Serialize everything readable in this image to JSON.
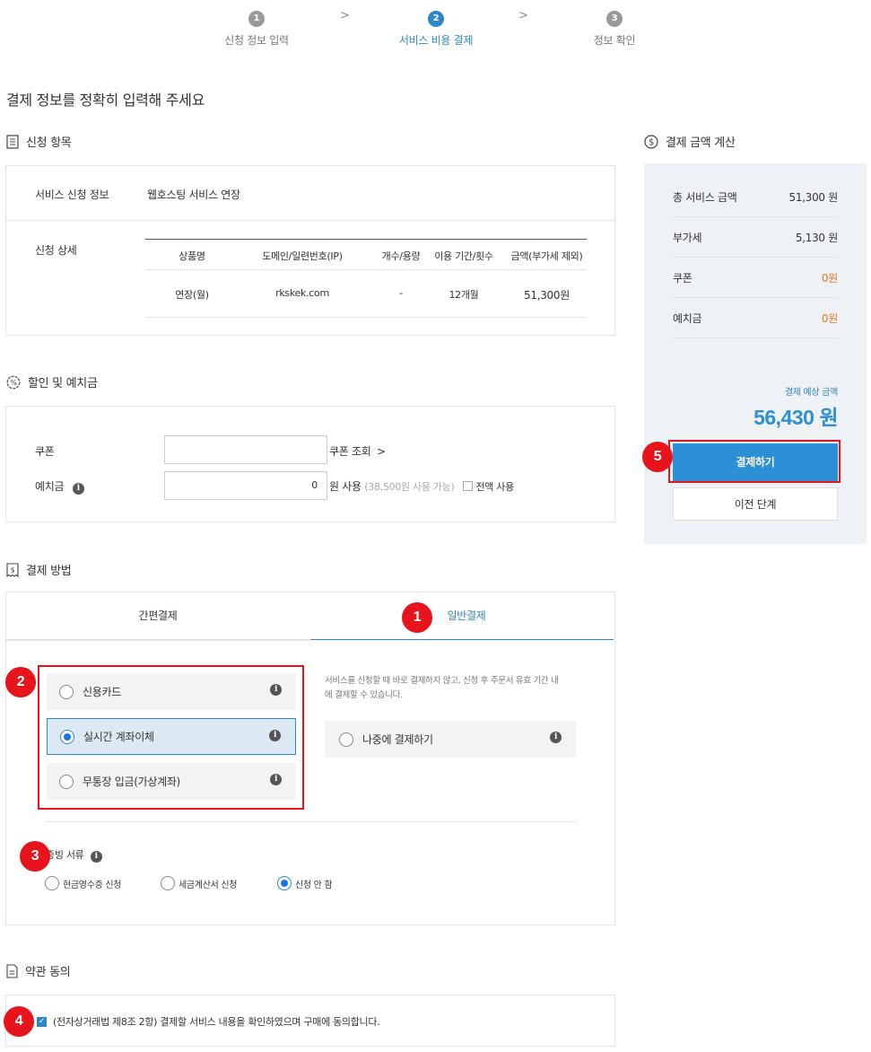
{
  "steps": [
    {
      "num": "1",
      "label": "신청 정보 입력"
    },
    {
      "num": "2",
      "label": "서비스 비용 결제"
    },
    {
      "num": "3",
      "label": "정보 확인"
    }
  ],
  "page_title": "결제 정보를 정확히 입력해 주세요",
  "application": {
    "heading": "신청 항목",
    "service_info_label": "서비스 신청 정보",
    "service_info_value": "웹호스팅 서비스 연장",
    "detail_label": "신청 상세",
    "table_headers": [
      "상품명",
      "도메인/일련번호(IP)",
      "개수/용량",
      "이용 기간/횟수",
      "금액(부가세 제외)"
    ],
    "table_row": [
      "연장(월)",
      "rkskek.com",
      "-",
      "12개월",
      "51,300원"
    ]
  },
  "discount": {
    "heading": "할인 및 예치금",
    "coupon_label": "쿠폰",
    "coupon_value": "",
    "coupon_lookup": "쿠폰 조회",
    "deposit_label": "예치금",
    "deposit_value": "0",
    "deposit_use": "원 사용",
    "deposit_available": "(38,500원 사용 가능)",
    "use_all": "전액 사용"
  },
  "payment": {
    "heading": "결제 방법",
    "tabs": [
      "간편결제",
      "일반결제"
    ],
    "options": [
      "신용카드",
      "실시간 계좌이체",
      "무통장 입금(가상계좌)"
    ],
    "later_desc_line1": "서비스를 신청할 때 바로 결제하지 않고, 신청 후 주문서 유효 기간 내",
    "later_desc_line2": "에 결제할 수 있습니다.",
    "later_option": "나중에 결제하기",
    "receipt_label": "증빙 서류",
    "receipt_options": [
      "현금영수증 신청",
      "세금계산서 신청",
      "신청 안 함"
    ]
  },
  "terms": {
    "heading": "약관 동의",
    "agree_text": "(전자상거래법 제8조 2항) 결제할 서비스 내용을 확인하였으며 구매에 동의합니다."
  },
  "summary": {
    "heading": "결제 금액 계산",
    "rows": [
      {
        "label": "총 서비스 금액",
        "value": "51,300 원"
      },
      {
        "label": "부가세",
        "value": "5,130 원"
      },
      {
        "label": "쿠폰",
        "value": "0원"
      },
      {
        "label": "예치금",
        "value": "0원"
      }
    ],
    "expected_label": "결제 예상 금액",
    "expected_value": "56,430 원",
    "pay_button": "결제하기",
    "prev_button": "이전 단계"
  },
  "badges": [
    "1",
    "2",
    "3",
    "4",
    "5"
  ],
  "colors": {
    "accent": "#2d86c6",
    "highlight": "#e8141b",
    "orange": "#f37321"
  }
}
